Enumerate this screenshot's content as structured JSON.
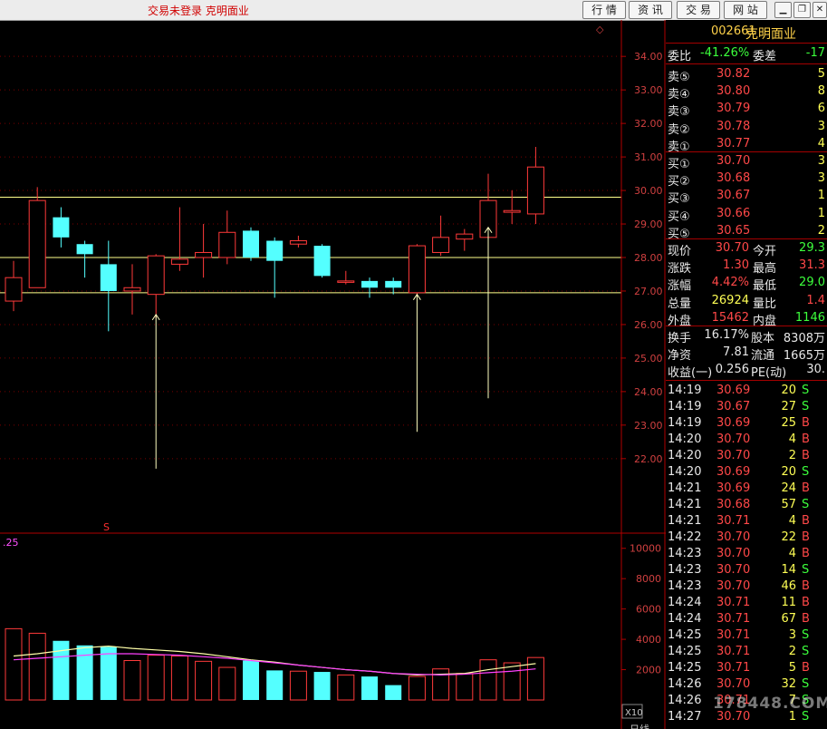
{
  "titlebar": {
    "login_status": "交易未登录  克明面业",
    "buttons": [
      "行 情",
      "资 讯",
      "交 易",
      "网 站"
    ]
  },
  "price_axis": {
    "ticks": [
      "34.00",
      "33.00",
      "32.00",
      "31.00",
      "30.00",
      "29.00",
      "28.00",
      "27.00",
      "26.00",
      "25.00",
      "24.00",
      "23.00",
      "22.00"
    ]
  },
  "volume_axis": {
    "ticks": [
      "10000",
      "8000",
      "6000",
      "4000",
      "2000"
    ],
    "unit": "X10",
    "left_label": ".25"
  },
  "chart_marks": {
    "s_marker": "S",
    "diamond": "◇",
    "bottom_label": "日线"
  },
  "chart_data": {
    "type": "candlestick",
    "price_range": [
      21.5,
      34.5
    ],
    "horizontal_lines": [
      29.8,
      28.0,
      26.95
    ],
    "candles": [
      {
        "o": 26.7,
        "c": 27.4,
        "h": 27.9,
        "l": 26.4
      },
      {
        "o": 27.1,
        "c": 29.7,
        "h": 30.1,
        "l": 27.1
      },
      {
        "o": 29.2,
        "c": 28.6,
        "h": 29.5,
        "l": 28.3
      },
      {
        "o": 28.4,
        "c": 28.1,
        "h": 28.5,
        "l": 27.4
      },
      {
        "o": 27.8,
        "c": 27.0,
        "h": 28.5,
        "l": 25.8
      },
      {
        "o": 27.0,
        "c": 27.1,
        "h": 27.8,
        "l": 26.3
      },
      {
        "o": 26.9,
        "c": 28.05,
        "h": 28.1,
        "l": 26.2
      },
      {
        "o": 27.8,
        "c": 27.95,
        "h": 29.5,
        "l": 27.6
      },
      {
        "o": 28.0,
        "c": 28.15,
        "h": 29.0,
        "l": 27.4
      },
      {
        "o": 28.0,
        "c": 28.75,
        "h": 29.4,
        "l": 27.8
      },
      {
        "o": 28.8,
        "c": 28.0,
        "h": 28.9,
        "l": 27.9
      },
      {
        "o": 28.5,
        "c": 27.9,
        "h": 28.6,
        "l": 26.8
      },
      {
        "o": 28.4,
        "c": 28.5,
        "h": 28.65,
        "l": 28.3
      },
      {
        "o": 28.35,
        "c": 27.45,
        "h": 28.4,
        "l": 27.4
      },
      {
        "o": 27.3,
        "c": 27.3,
        "h": 27.6,
        "l": 27.2
      },
      {
        "o": 27.3,
        "c": 27.1,
        "h": 27.4,
        "l": 26.8
      },
      {
        "o": 27.3,
        "c": 27.1,
        "h": 27.4,
        "l": 26.9
      },
      {
        "o": 26.95,
        "c": 28.35,
        "h": 28.4,
        "l": 26.9
      },
      {
        "o": 28.15,
        "c": 28.6,
        "h": 29.25,
        "l": 28.05
      },
      {
        "o": 28.55,
        "c": 28.7,
        "h": 28.85,
        "l": 28.2
      },
      {
        "o": 28.6,
        "c": 29.7,
        "h": 30.5,
        "l": 28.5
      },
      {
        "o": 29.35,
        "c": 29.4,
        "h": 30.0,
        "l": 29.0
      },
      {
        "o": 29.3,
        "c": 30.7,
        "h": 31.3,
        "l": 29.0
      }
    ],
    "arrows": [
      {
        "index": 6,
        "from": 21.7,
        "to": 26.3
      },
      {
        "index": 17,
        "from": 22.8,
        "to": 26.9
      },
      {
        "index": 20,
        "from": 23.8,
        "to": 28.9
      }
    ],
    "volume": [
      4700,
      4400,
      3900,
      3600,
      3500,
      2600,
      2950,
      2900,
      2550,
      2150,
      2600,
      1950,
      1900,
      1850,
      1650,
      1550,
      980,
      1550,
      2050,
      1750,
      2650,
      2450,
      2800
    ],
    "volume_range": [
      0,
      11000
    ],
    "ma_fast": [
      2900,
      3050,
      3250,
      3450,
      3550,
      3400,
      3300,
      3200,
      3050,
      2850,
      2650,
      2500,
      2300,
      2150,
      2000,
      1900,
      1750,
      1650,
      1700,
      1750,
      2000,
      2200,
      2400
    ],
    "ma_slow": [
      2650,
      2750,
      2850,
      2950,
      3050,
      3050,
      3000,
      2950,
      2850,
      2750,
      2600,
      2450,
      2300,
      2150,
      2000,
      1900,
      1750,
      1700,
      1650,
      1700,
      1800,
      1900,
      2050
    ],
    "colors": {
      "up": "#ff3a3a",
      "down": "#54ffff",
      "level_line": "#ffff8c",
      "ma_fast": "#ffffa8",
      "ma_slow": "#ff40ff"
    }
  },
  "panel": {
    "code": "002661",
    "name": "克明面业",
    "wei_bi_label": "委比",
    "wei_bi_value": "-41.26%",
    "wei_cha_label": "委差",
    "wei_cha_value": "-17",
    "sells": [
      {
        "label": "卖⑤",
        "price": "30.82",
        "vol": "5"
      },
      {
        "label": "卖④",
        "price": "30.80",
        "vol": "8"
      },
      {
        "label": "卖③",
        "price": "30.79",
        "vol": "6"
      },
      {
        "label": "卖②",
        "price": "30.78",
        "vol": "3"
      },
      {
        "label": "卖①",
        "price": "30.77",
        "vol": "4"
      }
    ],
    "buys": [
      {
        "label": "买①",
        "price": "30.70",
        "vol": "3"
      },
      {
        "label": "买②",
        "price": "30.68",
        "vol": "3"
      },
      {
        "label": "买③",
        "price": "30.67",
        "vol": "1"
      },
      {
        "label": "买④",
        "price": "30.66",
        "vol": "1"
      },
      {
        "label": "买⑤",
        "price": "30.65",
        "vol": "2"
      }
    ],
    "stats": [
      {
        "l1": "现价",
        "v1": "30.70",
        "c1": "red",
        "l2": "今开",
        "v2": "29.3",
        "c2": "green"
      },
      {
        "l1": "涨跌",
        "v1": "1.30",
        "c1": "red",
        "l2": "最高",
        "v2": "31.3",
        "c2": "red"
      },
      {
        "l1": "涨幅",
        "v1": "4.42%",
        "c1": "red",
        "l2": "最低",
        "v2": "29.0",
        "c2": "green"
      },
      {
        "l1": "总量",
        "v1": "26924",
        "c1": "yel",
        "l2": "量比",
        "v2": "1.4",
        "c2": "red"
      },
      {
        "l1": "外盘",
        "v1": "15462",
        "c1": "red",
        "l2": "内盘",
        "v2": "1146",
        "c2": "green"
      }
    ],
    "fundamentals": [
      {
        "l1": "换手",
        "v1": "16.17%",
        "l2": "股本",
        "v2": "8308万"
      },
      {
        "l1": "净资",
        "v1": "7.81",
        "l2": "流通",
        "v2": "1665万"
      },
      {
        "l1": "收益(一)",
        "v1": "0.256",
        "l2": "PE(动)",
        "v2": "30."
      }
    ],
    "ticks": [
      {
        "t": "14:19",
        "p": "30.69",
        "v": "20",
        "s": "S"
      },
      {
        "t": "14:19",
        "p": "30.67",
        "v": "27",
        "s": "S"
      },
      {
        "t": "14:19",
        "p": "30.69",
        "v": "25",
        "s": "B"
      },
      {
        "t": "14:20",
        "p": "30.70",
        "v": "4",
        "s": "B"
      },
      {
        "t": "14:20",
        "p": "30.70",
        "v": "2",
        "s": "B"
      },
      {
        "t": "14:20",
        "p": "30.69",
        "v": "20",
        "s": "S"
      },
      {
        "t": "14:21",
        "p": "30.69",
        "v": "24",
        "s": "B"
      },
      {
        "t": "14:21",
        "p": "30.68",
        "v": "57",
        "s": "S"
      },
      {
        "t": "14:21",
        "p": "30.71",
        "v": "4",
        "s": "B"
      },
      {
        "t": "14:22",
        "p": "30.70",
        "v": "22",
        "s": "B"
      },
      {
        "t": "14:23",
        "p": "30.70",
        "v": "4",
        "s": "B"
      },
      {
        "t": "14:23",
        "p": "30.70",
        "v": "14",
        "s": "S"
      },
      {
        "t": "14:23",
        "p": "30.70",
        "v": "46",
        "s": "B"
      },
      {
        "t": "14:24",
        "p": "30.71",
        "v": "11",
        "s": "B"
      },
      {
        "t": "14:24",
        "p": "30.71",
        "v": "67",
        "s": "B"
      },
      {
        "t": "14:25",
        "p": "30.71",
        "v": "3",
        "s": "S"
      },
      {
        "t": "14:25",
        "p": "30.71",
        "v": "2",
        "s": "S"
      },
      {
        "t": "14:25",
        "p": "30.71",
        "v": "5",
        "s": "B"
      },
      {
        "t": "14:26",
        "p": "30.70",
        "v": "32",
        "s": "S"
      },
      {
        "t": "14:26",
        "p": "30.71",
        "v": "7",
        "s": "S"
      },
      {
        "t": "14:27",
        "p": "30.70",
        "v": "1",
        "s": "S"
      }
    ],
    "watermark": "178448.COM"
  }
}
